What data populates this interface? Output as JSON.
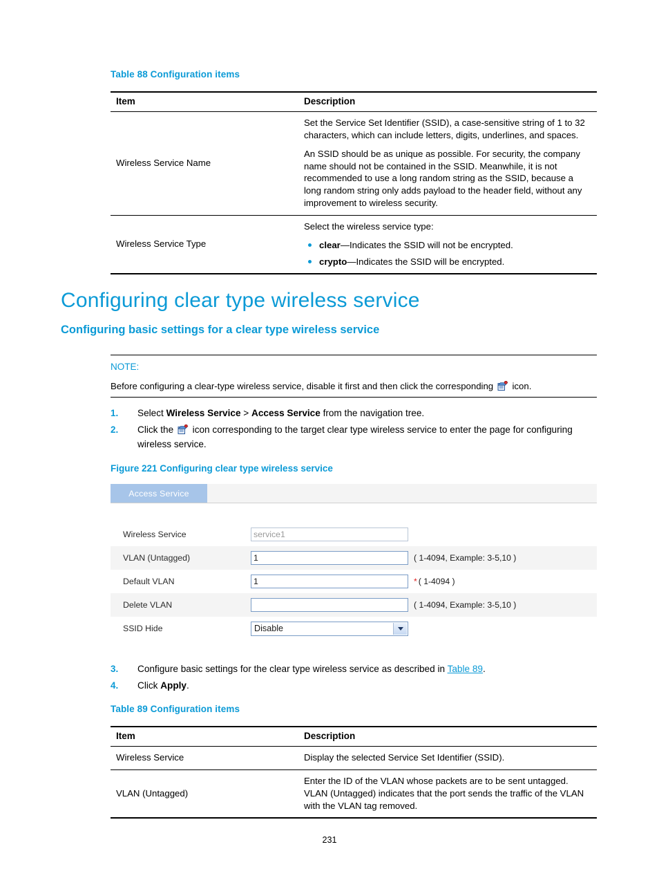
{
  "colors": {
    "accent": "#0b9ad6",
    "tab_bg": "#a7c5e9",
    "row_shade": "#f4f4f4",
    "required_star": "#e02020"
  },
  "table88": {
    "caption": "Table 88 Configuration items",
    "headers": [
      "Item",
      "Description"
    ],
    "rows": [
      {
        "item": "Wireless Service Name",
        "paragraphs": [
          "Set the Service Set Identifier (SSID), a case-sensitive string of 1 to 32 characters, which can include letters, digits, underlines, and spaces.",
          "An SSID should be as unique as possible. For security, the company name should not be contained in the SSID. Meanwhile, it is not recommended to use a long random string as the SSID, because a long random string only adds payload to the header field, without any improvement to wireless security."
        ]
      },
      {
        "item": "Wireless Service Type",
        "intro": "Select the wireless service type:",
        "bullets": [
          {
            "term": "clear",
            "dash": "—",
            "text": "Indicates the SSID will not be encrypted."
          },
          {
            "term": "crypto",
            "dash": "—",
            "text": "Indicates the SSID will be encrypted."
          }
        ]
      }
    ]
  },
  "headings": {
    "h1": "Configuring clear type wireless service",
    "h2": "Configuring basic settings for a clear type wireless service"
  },
  "note": {
    "label": "NOTE:",
    "text_before": "Before configuring a clear-type wireless service, disable it first and then click the corresponding",
    "icon": "wireless-service-node-icon",
    "text_after": "icon."
  },
  "steps_top": [
    {
      "num": "1.",
      "parts": [
        {
          "type": "text",
          "value": "Select "
        },
        {
          "type": "bold",
          "value": "Wireless Service"
        },
        {
          "type": "text",
          "value": " > "
        },
        {
          "type": "bold",
          "value": "Access Service"
        },
        {
          "type": "text",
          "value": " from the navigation tree."
        }
      ]
    },
    {
      "num": "2.",
      "parts": [
        {
          "type": "text",
          "value": "Click the "
        },
        {
          "type": "icon",
          "value": "wireless-service-node-icon"
        },
        {
          "type": "text",
          "value": " icon corresponding to the target clear type wireless service to enter the page for configuring wireless service."
        }
      ]
    }
  ],
  "figure": {
    "caption": "Figure 221 Configuring clear type wireless service",
    "tab_label": "Access Service",
    "rows": [
      {
        "label": "Wireless Service",
        "control": "input",
        "value": "service1",
        "readonly": true,
        "hint": "",
        "required": false,
        "shaded": false
      },
      {
        "label": "VLAN (Untagged)",
        "control": "input",
        "value": "1",
        "readonly": false,
        "hint": "( 1-4094, Example: 3-5,10 )",
        "required": false,
        "shaded": true
      },
      {
        "label": "Default VLAN",
        "control": "input",
        "value": "1",
        "readonly": false,
        "hint": "( 1-4094 )",
        "required": true,
        "shaded": false
      },
      {
        "label": "Delete VLAN",
        "control": "input",
        "value": "",
        "readonly": false,
        "hint": "( 1-4094, Example: 3-5,10 )",
        "required": false,
        "shaded": true
      },
      {
        "label": "SSID Hide",
        "control": "select",
        "value": "Disable",
        "readonly": false,
        "hint": "",
        "required": false,
        "shaded": false
      }
    ]
  },
  "steps_bottom": [
    {
      "num": "3.",
      "parts": [
        {
          "type": "text",
          "value": "Configure basic settings for the clear type wireless service as described in "
        },
        {
          "type": "xref",
          "value": "Table 89"
        },
        {
          "type": "text",
          "value": "."
        }
      ]
    },
    {
      "num": "4.",
      "parts": [
        {
          "type": "text",
          "value": "Click "
        },
        {
          "type": "bold",
          "value": "Apply"
        },
        {
          "type": "text",
          "value": "."
        }
      ]
    }
  ],
  "table89": {
    "caption": "Table 89 Configuration items",
    "headers": [
      "Item",
      "Description"
    ],
    "rows": [
      {
        "item": "Wireless Service",
        "paragraphs": [
          "Display the selected Service Set Identifier (SSID)."
        ]
      },
      {
        "item": "VLAN (Untagged)",
        "paragraphs": [
          "Enter the ID of the VLAN whose packets are to be sent untagged. VLAN (Untagged) indicates that the port sends the traffic of the VLAN with the VLAN tag removed."
        ]
      }
    ]
  },
  "page_number": "231"
}
